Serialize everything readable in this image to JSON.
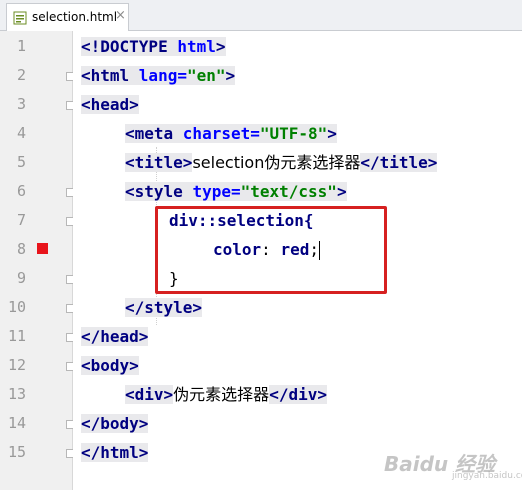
{
  "tab": {
    "label": "selection.html",
    "close": "×",
    "icon": "html-file-icon"
  },
  "line_numbers": [
    "1",
    "2",
    "3",
    "4",
    "5",
    "6",
    "7",
    "8",
    "9",
    "10",
    "11",
    "12",
    "13",
    "14",
    "15"
  ],
  "code": {
    "l1": {
      "a": "<!DOCTYPE ",
      "b": "html",
      "c": ">"
    },
    "l2": {
      "a": "<html ",
      "b": "lang=",
      "c": "\"en\"",
      "d": ">"
    },
    "l3": {
      "a": "<head>"
    },
    "l4": {
      "a": "<meta ",
      "b": "charset=",
      "c": "\"UTF-8\"",
      "d": ">"
    },
    "l5": {
      "a": "<title>",
      "b": "selection伪元素选择器",
      "c": "</title>"
    },
    "l6": {
      "a": "<style ",
      "b": "type=",
      "c": "\"text/css\"",
      "d": ">"
    },
    "l7": {
      "a": "div::selection{"
    },
    "l8": {
      "a": "color",
      "b": ": ",
      "c": "red",
      "d": ";"
    },
    "l9": {
      "a": "}"
    },
    "l10": {
      "a": "</style>"
    },
    "l11": {
      "a": "</head>"
    },
    "l12": {
      "a": "<body>"
    },
    "l13": {
      "a": "<div>",
      "b": "伪元素选择器",
      "c": "</div>"
    },
    "l14": {
      "a": "</body>"
    },
    "l15": {
      "a": "</html>"
    }
  },
  "breakpoint_line": "8",
  "colors": {
    "breakpoint": "#e8141b",
    "highlight_box": "#d62020",
    "tag": "#000080",
    "attribute": "#0000ff",
    "string": "#008000"
  },
  "watermark": {
    "main": "Baidu 经验",
    "sub": "jingyan.baidu.com"
  }
}
